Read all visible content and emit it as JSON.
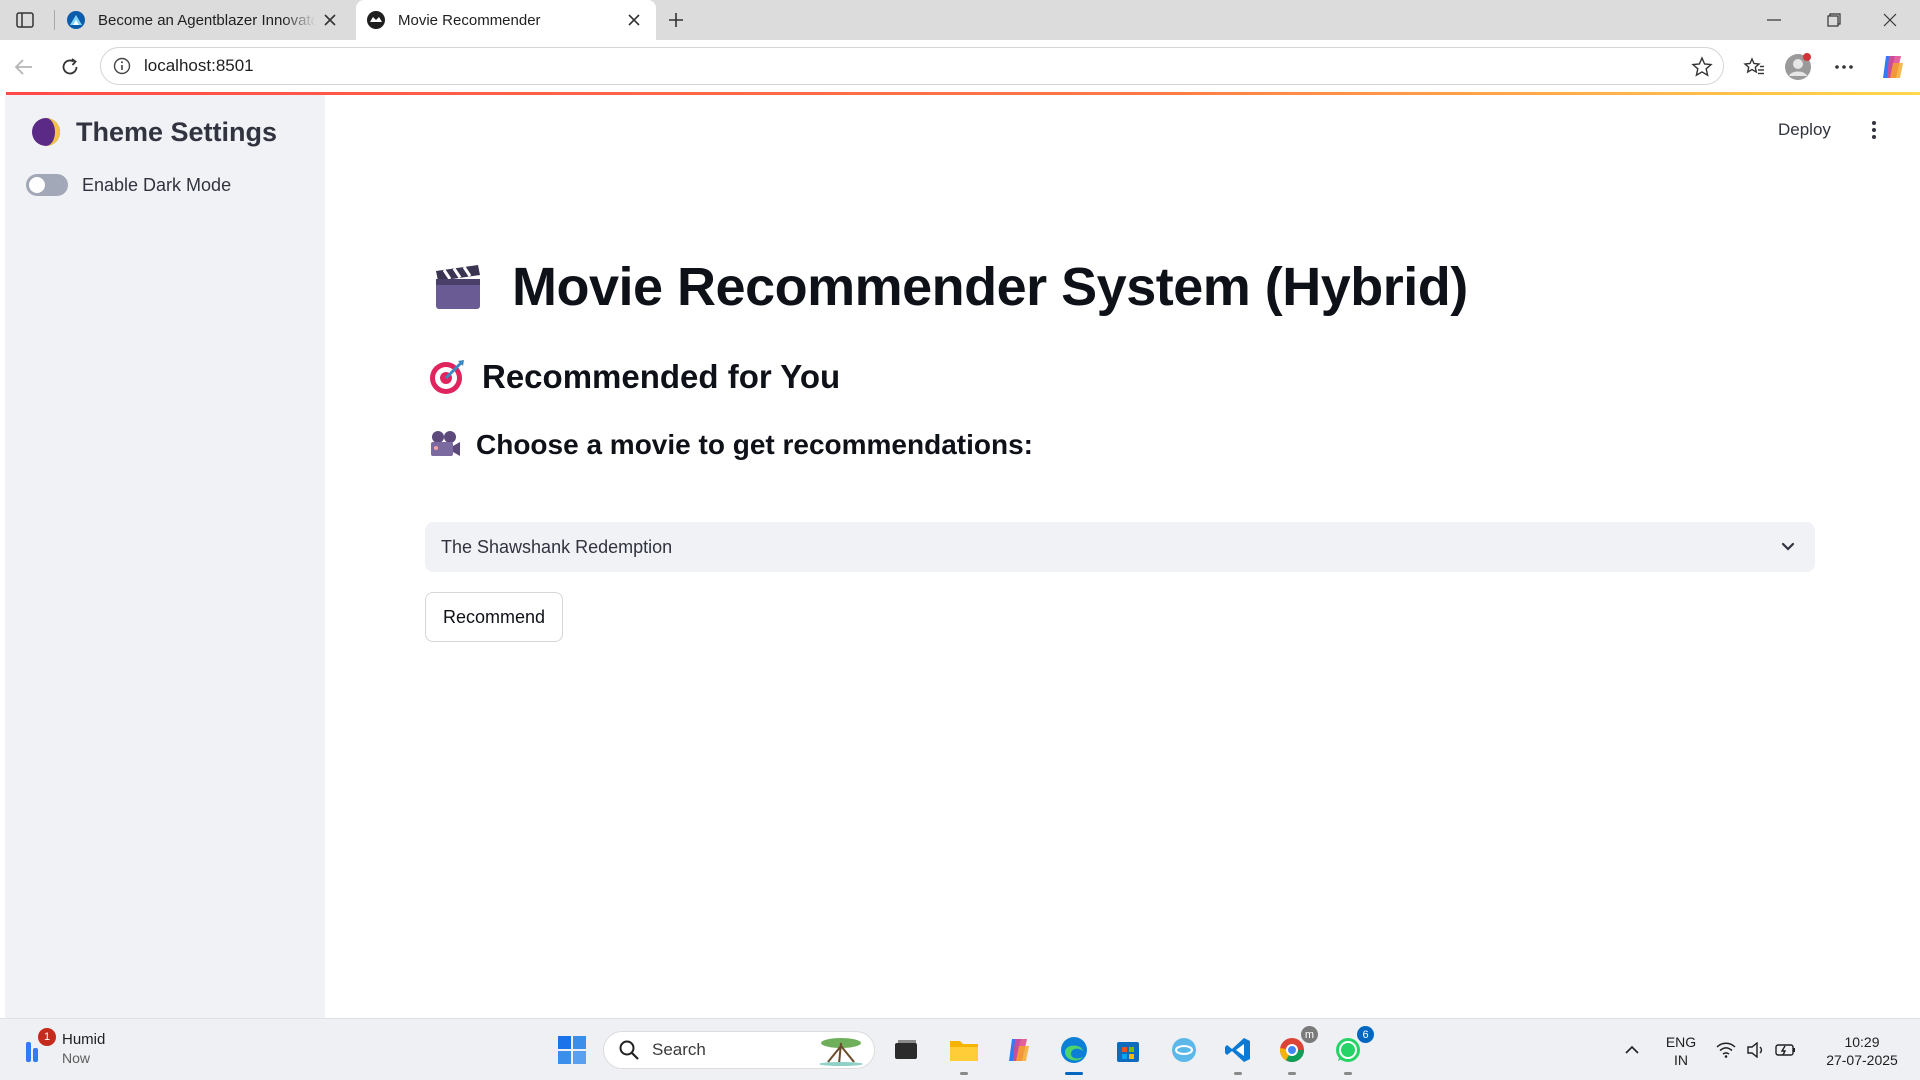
{
  "browser": {
    "tabs": [
      {
        "title": "Become an Agentblazer Innovator",
        "active": false,
        "favicon": "trailhead-favicon-icon"
      },
      {
        "title": "Movie Recommender",
        "active": true,
        "favicon": "streamlit-favicon-icon"
      }
    ],
    "url": "localhost:8501"
  },
  "app": {
    "deploy_label": "Deploy",
    "sidebar": {
      "title": "Theme Settings",
      "title_icon": "moon-icon",
      "toggle_label": "Enable Dark Mode",
      "toggle_on": false
    },
    "title": "Movie Recommender System (Hybrid)",
    "title_icon": "clapper-board-icon",
    "subheader": "Recommended for You",
    "subheader_icon": "target-icon",
    "select_label": "Choose a movie to get recommendations:",
    "select_label_icon": "movie-camera-icon",
    "selected_movie": "The Shawshank Redemption",
    "button_label": "Recommend",
    "colors": {
      "accent": "#ff4b4b",
      "sidebar_bg": "#f0f2f6",
      "text": "#31333f"
    }
  },
  "taskbar": {
    "weather_title": "Humid",
    "weather_sub": "Now",
    "weather_badge": "1",
    "search_placeholder": "Search",
    "language_line1": "ENG",
    "language_line2": "IN",
    "time": "10:29",
    "date": "27-07-2025",
    "whatsapp_badge": "6",
    "chrome_badge": "m"
  }
}
